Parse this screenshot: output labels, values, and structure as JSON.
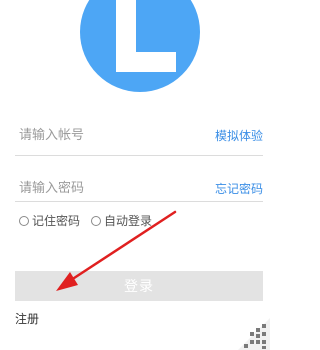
{
  "account": {
    "placeholder": "请输入帐号",
    "link": "模拟体验"
  },
  "password": {
    "placeholder": "请输入密码",
    "link": "忘记密码"
  },
  "options": {
    "remember_label": "记住密码",
    "auto_login_label": "自动登录"
  },
  "login_button_label": "登录",
  "register_link": "注册",
  "colors": {
    "logo": "#4da6f5",
    "link": "#3a8ee6",
    "button_bg": "#e3e3e3",
    "annotation_arrow": "#e02020"
  },
  "icons": {
    "logo": "L-logo-icon",
    "qr": "qr-code-icon",
    "annotation": "red-arrow-annotation"
  }
}
